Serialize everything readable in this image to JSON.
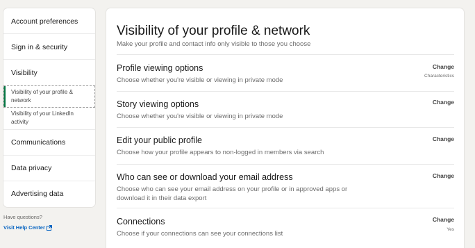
{
  "sidebar": {
    "items": [
      {
        "label": "Account preferences"
      },
      {
        "label": "Sign in & security"
      },
      {
        "label": "Visibility"
      },
      {
        "label": "Communications"
      },
      {
        "label": "Data privacy"
      },
      {
        "label": "Advertising data"
      }
    ],
    "sub_items": [
      {
        "label": "Visibility of your profile & network"
      },
      {
        "label": "Visibility of your LinkedIn activity"
      }
    ],
    "active_color": "#057642"
  },
  "help": {
    "question": "Have questions?",
    "link_label": "Visit Help Center",
    "link_icon": "external-link-icon",
    "link_color": "#0a66c2"
  },
  "main": {
    "title": "Visibility of your profile & network",
    "subtitle": "Make your profile and contact info only visible to those you choose",
    "rows": [
      {
        "title": "Profile viewing options",
        "desc": "Choose whether you're visible or viewing in private mode",
        "action": "Change",
        "status": "Characteristics"
      },
      {
        "title": "Story viewing options",
        "desc": "Choose whether you're visible or viewing in private mode",
        "action": "Change",
        "status": ""
      },
      {
        "title": "Edit your public profile",
        "desc": "Choose how your profile appears to non-logged in members via search",
        "action": "Change",
        "status": ""
      },
      {
        "title": "Who can see or download your email address",
        "desc": "Choose who can see your email address on your profile or in approved apps or download it in their data export",
        "action": "Change",
        "status": ""
      },
      {
        "title": "Connections",
        "desc": "Choose if your connections can see your connections list",
        "action": "Change",
        "status": "Yes"
      }
    ]
  }
}
